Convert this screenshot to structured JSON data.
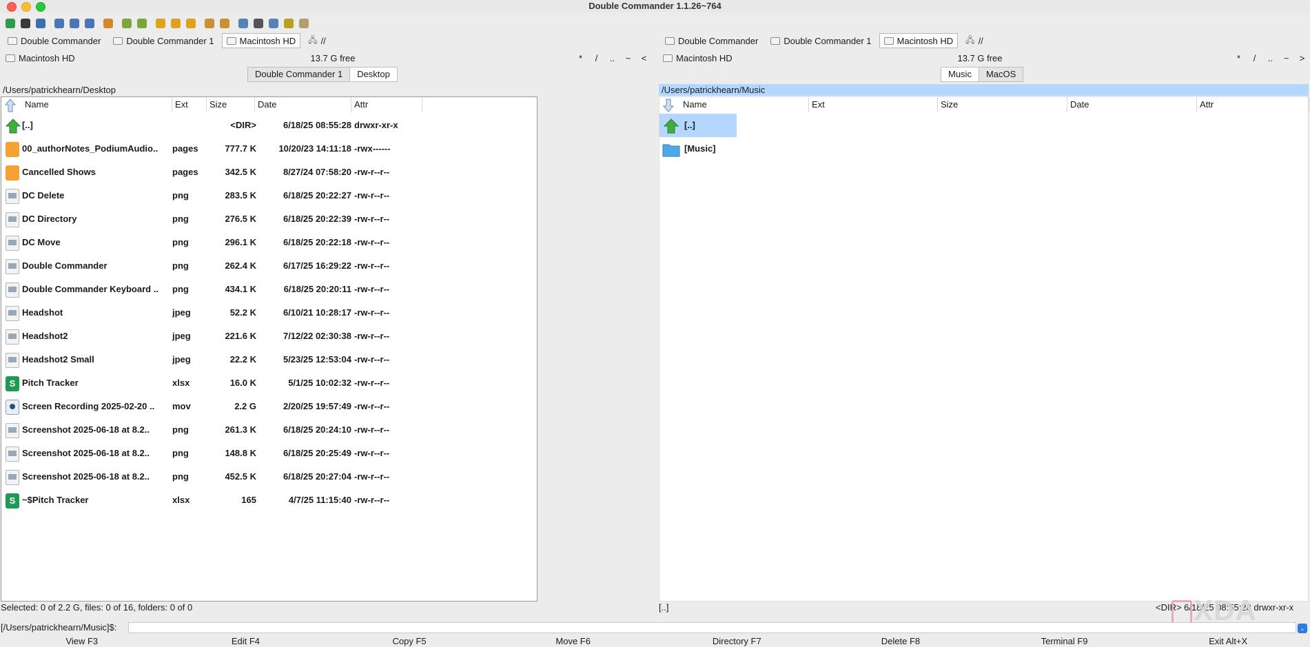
{
  "window": {
    "title": "Double Commander 1.1.26~764"
  },
  "toolbar": {
    "icons": [
      "refresh-icon",
      "terminal-icon",
      "settings-icon",
      "brief-view-icon",
      "full-view-icon",
      "thumbnail-view-icon",
      "sync-dirs-icon",
      "copy-left-icon",
      "copy-right-icon",
      "multi-rename-icon",
      "compare-icon",
      "link-icon",
      "pack-icon",
      "unpack-icon",
      "find-files-icon",
      "search-icon",
      "edit-icon",
      "view-icon",
      "copy-path-icon"
    ],
    "colors": [
      "#2e9d4a",
      "#3a3a3a",
      "#3a6fb0",
      "#4a76b8",
      "#4a76b8",
      "#4a76b8",
      "#d08a2a",
      "#7aa63a",
      "#7aa63a",
      "#e0a020",
      "#e0a020",
      "#e0a020",
      "#c9912f",
      "#c9912f",
      "#5a80b8",
      "#555555",
      "#5a80b8",
      "#b8a020",
      "#b0a070"
    ]
  },
  "left": {
    "tabs": [
      {
        "label": "Double Commander",
        "active": false
      },
      {
        "label": "Double Commander 1",
        "active": false
      },
      {
        "label": "Macintosh HD",
        "active": true
      }
    ],
    "net_label": "//",
    "drive": "Macintosh HD",
    "free": "13.7 G free",
    "nav": [
      "*",
      "/",
      "..",
      "~",
      "<"
    ],
    "path_tabs": [
      {
        "label": "Double Commander 1",
        "active": false
      },
      {
        "label": "Desktop",
        "active": true
      }
    ],
    "path": "/Users/patrickhearn/Desktop",
    "columns": {
      "name": "Name",
      "ext": "Ext",
      "size": "Size",
      "date": "Date",
      "attr": "Attr"
    },
    "rows": [
      {
        "icon": "parent-dir-icon",
        "name": "[..]",
        "ext": "",
        "size": "<DIR>",
        "date": "6/18/25 08:55:28",
        "attr": "drwxr-xr-x"
      },
      {
        "icon": "pages-file-icon",
        "name": "00_authorNotes_PodiumAudio..",
        "ext": "pages",
        "size": "777.7 K",
        "date": "10/20/23 14:11:18",
        "attr": "-rwx------"
      },
      {
        "icon": "pages-file-icon",
        "name": "Cancelled Shows",
        "ext": "pages",
        "size": "342.5 K",
        "date": "8/27/24 07:58:20",
        "attr": "-rw-r--r--"
      },
      {
        "icon": "image-file-icon",
        "name": "DC Delete",
        "ext": "png",
        "size": "283.5 K",
        "date": "6/18/25 20:22:27",
        "attr": "-rw-r--r--"
      },
      {
        "icon": "image-file-icon",
        "name": "DC Directory",
        "ext": "png",
        "size": "276.5 K",
        "date": "6/18/25 20:22:39",
        "attr": "-rw-r--r--"
      },
      {
        "icon": "image-file-icon",
        "name": "DC Move",
        "ext": "png",
        "size": "296.1 K",
        "date": "6/18/25 20:22:18",
        "attr": "-rw-r--r--"
      },
      {
        "icon": "image-file-icon",
        "name": "Double Commander",
        "ext": "png",
        "size": "262.4 K",
        "date": "6/17/25 16:29:22",
        "attr": "-rw-r--r--"
      },
      {
        "icon": "image-file-icon",
        "name": "Double Commander Keyboard ..",
        "ext": "png",
        "size": "434.1 K",
        "date": "6/18/25 20:20:11",
        "attr": "-rw-r--r--"
      },
      {
        "icon": "image-file-icon",
        "name": "Headshot",
        "ext": "jpeg",
        "size": "52.2 K",
        "date": "6/10/21 10:28:17",
        "attr": "-rw-r--r--"
      },
      {
        "icon": "image-file-icon",
        "name": "Headshot2",
        "ext": "jpeg",
        "size": "221.6 K",
        "date": "7/12/22 02:30:38",
        "attr": "-rw-r--r--"
      },
      {
        "icon": "image-file-icon",
        "name": "Headshot2 Small",
        "ext": "jpeg",
        "size": "22.2 K",
        "date": "5/23/25 12:53:04",
        "attr": "-rw-r--r--"
      },
      {
        "icon": "spreadsheet-file-icon",
        "name": "Pitch Tracker",
        "ext": "xlsx",
        "size": "16.0 K",
        "date": "5/1/25 10:02:32",
        "attr": "-rw-r--r--"
      },
      {
        "icon": "video-file-icon",
        "name": "Screen Recording 2025-02-20 ..",
        "ext": "mov",
        "size": "2.2 G",
        "date": "2/20/25 19:57:49",
        "attr": "-rw-r--r--"
      },
      {
        "icon": "image-file-icon",
        "name": "Screenshot 2025-06-18 at 8.2..",
        "ext": "png",
        "size": "261.3 K",
        "date": "6/18/25 20:24:10",
        "attr": "-rw-r--r--"
      },
      {
        "icon": "image-file-icon",
        "name": "Screenshot 2025-06-18 at 8.2..",
        "ext": "png",
        "size": "148.8 K",
        "date": "6/18/25 20:25:49",
        "attr": "-rw-r--r--"
      },
      {
        "icon": "image-file-icon",
        "name": "Screenshot 2025-06-18 at 8.2..",
        "ext": "png",
        "size": "452.5 K",
        "date": "6/18/25 20:27:04",
        "attr": "-rw-r--r--"
      },
      {
        "icon": "spreadsheet-file-icon",
        "name": "~$Pitch Tracker",
        "ext": "xlsx",
        "size": "165",
        "date": "4/7/25 11:15:40",
        "attr": "-rw-r--r--"
      }
    ],
    "status": "Selected: 0 of 2.2 G, files: 0 of 16, folders: 0 of 0"
  },
  "right": {
    "tabs": [
      {
        "label": "Double Commander",
        "active": false
      },
      {
        "label": "Double Commander 1",
        "active": false
      },
      {
        "label": "Macintosh HD",
        "active": true
      }
    ],
    "net_label": "//",
    "drive": "Macintosh HD",
    "free": "13.7 G free",
    "nav": [
      "*",
      "/",
      "..",
      "~",
      ">"
    ],
    "path_tabs": [
      {
        "label": "Music",
        "active": true
      },
      {
        "label": "MacOS",
        "active": false
      }
    ],
    "path": "/Users/patrickhearn/Music",
    "columns": {
      "name": "Name",
      "ext": "Ext",
      "size": "Size",
      "date": "Date",
      "attr": "Attr"
    },
    "rows": [
      {
        "icon": "parent-dir-icon",
        "name": "[..]",
        "selected": true
      },
      {
        "icon": "folder-icon",
        "name": "[Music]",
        "selected": false
      }
    ],
    "status_left": "[..]",
    "status_right": "<DIR>  6/18/25 08:55:28  drwxr-xr-x"
  },
  "cmdline": {
    "prompt": "[/Users/patrickhearn/Music]$:"
  },
  "fkeys": [
    "View F3",
    "Edit F4",
    "Copy F5",
    "Move F6",
    "Directory F7",
    "Delete F8",
    "Terminal F9",
    "Exit Alt+X"
  ],
  "watermark": "XDA"
}
